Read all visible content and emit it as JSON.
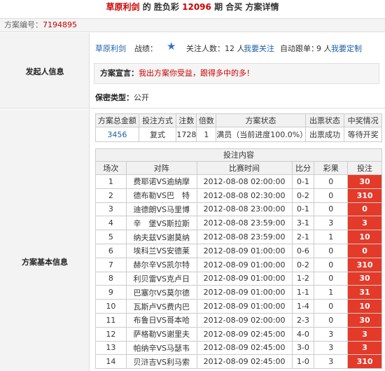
{
  "header": {
    "initiator": "草原利剑",
    "text_de": "的",
    "lottery": "胜负彩",
    "issue": "12096",
    "text_period": "期",
    "buy_type": "合买",
    "text_detail": "方案详情"
  },
  "plan_no": {
    "label": "方案编号：",
    "value": "7194895"
  },
  "sections": {
    "initiator_info": "发起人信息",
    "basic_info": "方案基本信息"
  },
  "initiator": {
    "name": "草原利剑",
    "record_label": "战绩：",
    "record_icon": "star-icon",
    "follow_count_label": "关注人数：",
    "follow_count": "12 人",
    "follow_link": "我要关注",
    "auto_follow_label": "自动跟单：",
    "auto_follow_count": "9 人",
    "auto_follow_link": "我要定制",
    "declare_label": "方案宣言：",
    "declare_text": "我出方案你受益，跟得多中的多！",
    "secret_label": "保密类型：",
    "secret_value": "公开"
  },
  "summary": {
    "headers": [
      "方案总金额",
      "投注方式",
      "注数",
      "倍数",
      "方案状态",
      "出票状态",
      "中奖情况"
    ],
    "values": [
      "3456",
      "复式",
      "1728",
      "1",
      "满员（当前进度100.0%）",
      "出票成功",
      "等待开奖"
    ]
  },
  "detail": {
    "caption": "投注内容",
    "headers": [
      "场次",
      "对阵",
      "比赛时间",
      "比分",
      "彩果",
      "投注"
    ],
    "rows": [
      [
        "1",
        "费耶诺VS逾納摩",
        "2012-08-08 02:00:00",
        "0-1",
        "0",
        "30"
      ],
      [
        "2",
        "德布勒VS巴　特",
        "2012-08-08 02:30:00",
        "0-2",
        "0",
        "310"
      ],
      [
        "3",
        "迪德朗VS马里博",
        "2012-08-08 23:00:00",
        "0-1",
        "0",
        "0"
      ],
      [
        "4",
        "辛　堡VS斯拉斯",
        "2012-08-08 23:59:00",
        "3-1",
        "3",
        "3"
      ],
      [
        "5",
        "纳夫兹VS谢莫纳",
        "2012-08-08 23:59:00",
        "2-1",
        "1",
        "10"
      ],
      [
        "6",
        "埃科兰VS安德莱",
        "2012-08-09 01:00:00",
        "0-6",
        "0",
        "0"
      ],
      [
        "7",
        "赫尔辛VS凯尔特",
        "2012-08-09 01:00:00",
        "0-2",
        "0",
        "310"
      ],
      [
        "8",
        "利贝雷VS克卢日",
        "2012-08-09 01:00:00",
        "1-2",
        "0",
        "30"
      ],
      [
        "9",
        "巴塞尔VS莫尔德",
        "2012-08-09 01:00:00",
        "1-1",
        "1",
        "31"
      ],
      [
        "10",
        "瓦斯卢VS费内巴",
        "2012-08-09 01:00:00",
        "1-4",
        "0",
        "10"
      ],
      [
        "11",
        "布鲁日VS哥本哈",
        "2012-08-09 02:00:00",
        "2-3",
        "0",
        "30"
      ],
      [
        "12",
        "萨格勒VS谢里夫",
        "2012-08-09 02:45:00",
        "4-0",
        "3",
        "3"
      ],
      [
        "13",
        "帕纳辛VS马瑟韦",
        "2012-08-09 02:45:00",
        "3-0",
        "3",
        "3"
      ],
      [
        "14",
        "贝浒吉VS利马索",
        "2012-08-09 02:45:00",
        "1-0",
        "3",
        "310"
      ]
    ]
  }
}
